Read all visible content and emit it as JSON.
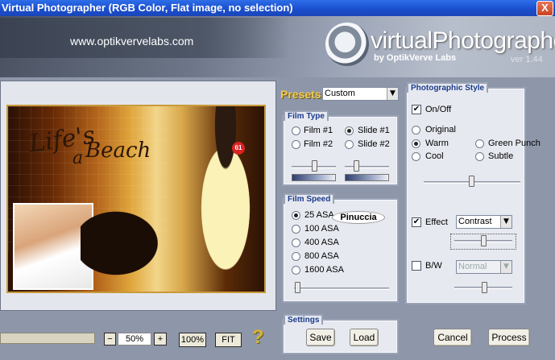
{
  "window": {
    "title": "Virtual Photographer (RGB Color, Flat image, no selection)",
    "close_glyph": "X"
  },
  "banner": {
    "url": "www.optikvervelabs.com",
    "logo_title": "virtualPhotographer",
    "logo_sub": "by OptikVerve Labs",
    "version": "ver 1.44"
  },
  "preview": {
    "text_lifes": "Life's",
    "text_a": "a",
    "text_beach": "Beach",
    "badge": "61"
  },
  "zoom": {
    "minus": "−",
    "value": "50%",
    "plus": "+",
    "hundred": "100%",
    "fit": "FIT",
    "help": "?"
  },
  "presets": {
    "label": "Presets",
    "value": "Custom"
  },
  "film_type": {
    "title": "Film Type",
    "options": [
      "Film #1",
      "Slide #1",
      "Film #2",
      "Slide #2"
    ],
    "selected": "Slide #1"
  },
  "film_speed": {
    "title": "Film Speed",
    "options": [
      "25 ASA",
      "100 ASA",
      "400 ASA",
      "800 ASA",
      "1600 ASA"
    ],
    "selected": "25 ASA",
    "watermark": "Pinuccia"
  },
  "settings": {
    "title": "Settings",
    "save": "Save",
    "load": "Load"
  },
  "photographic_style": {
    "title": "Photographic Style",
    "onoff_label": "On/Off",
    "onoff_checked": true,
    "styles": [
      "Original",
      "Warm",
      "Green Punch",
      "Cool",
      "Subtle"
    ],
    "selected_style": "Warm",
    "effect_label": "Effect",
    "effect_checked": true,
    "effect_value": "Contrast",
    "bw_label": "B/W",
    "bw_checked": false,
    "bw_value": "Normal"
  },
  "actions": {
    "cancel": "Cancel",
    "process": "Process"
  },
  "check_glyph": "✔",
  "arrow_glyph": "▼"
}
